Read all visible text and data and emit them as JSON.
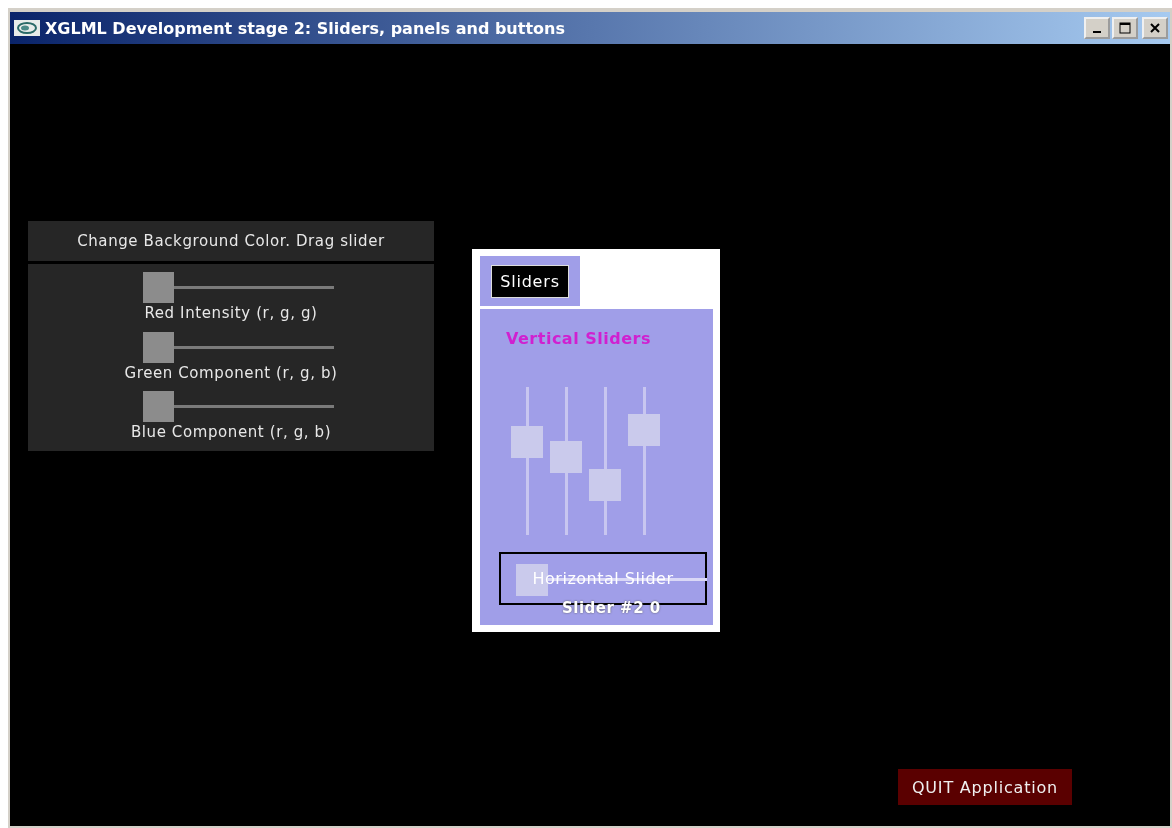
{
  "window": {
    "title": "XGLML Development stage 2: Sliders, panels and buttons"
  },
  "color_panel": {
    "title": "Change Background Color. Drag slider",
    "sliders": [
      {
        "label": "Red Intensity (r, g, g)",
        "level": 0
      },
      {
        "label": "Green Component (r, g, b)",
        "level": 0
      },
      {
        "label": "Blue Component (r, g, b)",
        "level": 0
      }
    ]
  },
  "sliders_panel": {
    "tab": {
      "label": "Sliders",
      "selected": true
    },
    "heading": "Vertical Sliders",
    "vertical_sliders": [
      {
        "level": 0.63
      },
      {
        "level": 0.53
      },
      {
        "level": 0.34
      },
      {
        "level": 0.71
      }
    ],
    "horizontal_slider": {
      "label": "Horizontal Slider",
      "level": 0,
      "reading": "Slider #2 0"
    }
  },
  "quit_button": {
    "label": "QUIT Application"
  }
}
